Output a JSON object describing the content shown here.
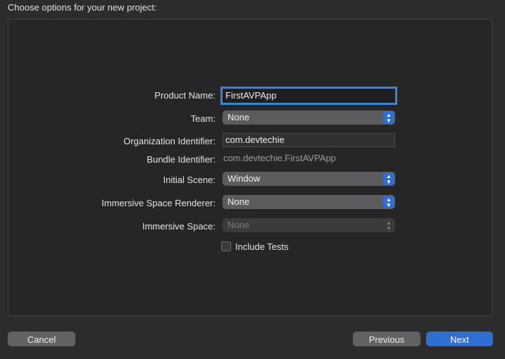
{
  "header": {
    "title": "Choose options for your new project:"
  },
  "form": {
    "product_name": {
      "label": "Product Name:",
      "value": "FirstAVPApp"
    },
    "team": {
      "label": "Team:",
      "value": "None"
    },
    "organization_identifier": {
      "label": "Organization Identifier:",
      "value": "com.devtechie"
    },
    "bundle_identifier": {
      "label": "Bundle Identifier:",
      "value": "com.devtechie.FirstAVPApp"
    },
    "initial_scene": {
      "label": "Initial Scene:",
      "value": "Window"
    },
    "immersive_space_renderer": {
      "label": "Immersive Space Renderer:",
      "value": "None"
    },
    "immersive_space": {
      "label": "Immersive Space:",
      "value": "None",
      "disabled": true
    },
    "include_tests": {
      "label": "Include Tests",
      "checked": false
    }
  },
  "footer": {
    "cancel_label": "Cancel",
    "previous_label": "Previous",
    "next_label": "Next"
  },
  "colors": {
    "accent": "#2f6fd2",
    "focus_ring": "#3d84d8"
  }
}
